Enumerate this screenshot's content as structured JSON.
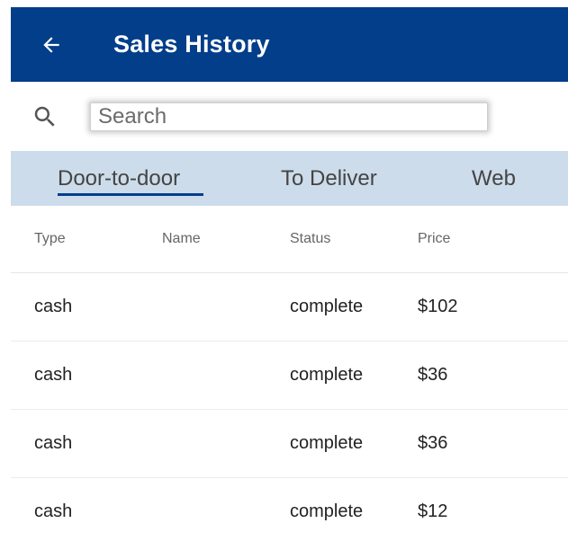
{
  "appbar": {
    "title": "Sales History",
    "back_icon": "arrow-left-icon"
  },
  "search": {
    "icon": "search-icon",
    "placeholder": "Search",
    "value": ""
  },
  "tabs": [
    {
      "label": "Door-to-door",
      "active": true
    },
    {
      "label": "To Deliver",
      "active": false
    },
    {
      "label": "Web",
      "active": false
    }
  ],
  "table": {
    "headers": {
      "type": "Type",
      "name": "Name",
      "status": "Status",
      "price": "Price"
    },
    "rows": [
      {
        "type": "cash",
        "name": "",
        "status": "complete",
        "price": "$102"
      },
      {
        "type": "cash",
        "name": "",
        "status": "complete",
        "price": "$36"
      },
      {
        "type": "cash",
        "name": "",
        "status": "complete",
        "price": "$36"
      },
      {
        "type": "cash",
        "name": "",
        "status": "complete",
        "price": "$12"
      }
    ]
  },
  "colors": {
    "appbar_bg": "#023e8a",
    "tabs_bg": "#cddcea",
    "active_tab_indicator": "#023e8a"
  }
}
